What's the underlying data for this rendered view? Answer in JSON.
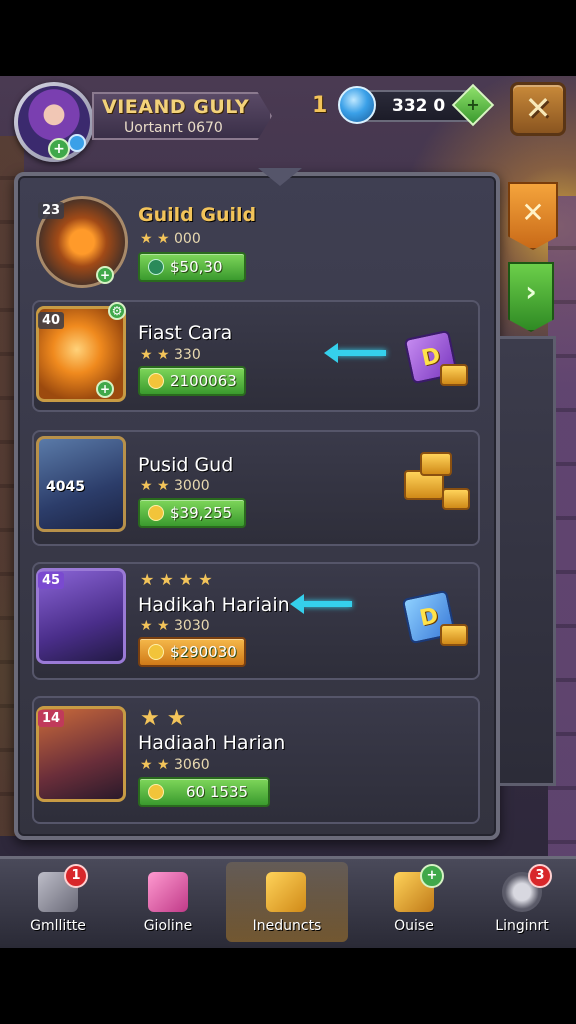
{
  "header": {
    "player_name": "VIEAND GULY",
    "player_subtitle": "Uortanrt 0670",
    "avatar_badge": "+",
    "level": "1",
    "currency_value": "332 0",
    "currency_add": "+",
    "close_label": "✕"
  },
  "side_tabs": {
    "close": "✕",
    "next": "›"
  },
  "rows": [
    {
      "level": "23",
      "title": "Guild Guild",
      "stars": "★ ★",
      "stars_value": "000",
      "price": "$50,30",
      "price_style": "green"
    },
    {
      "level": "40",
      "title": "Fiast Cara",
      "stars": "★ ★",
      "stars_value": "330",
      "price": "2100063",
      "price_style": "green",
      "reward_letter": "D"
    },
    {
      "level": "4045",
      "title": "Pusid Gud",
      "stars": "★ ★",
      "stars_value": "3000",
      "price": "$39,255",
      "price_style": "green"
    },
    {
      "level": "45",
      "title": "Hadikah Hariain",
      "top_stars": "★ ★ ★ ★",
      "stars": "★ ★",
      "stars_value": "3030",
      "price": "$290030",
      "price_style": "orange",
      "reward_letter": "D"
    },
    {
      "level": "14",
      "title": "Hadiaah Harian",
      "top_stars": "★ ★",
      "stars": "★ ★",
      "stars_value": "3060",
      "price": "60 1535",
      "price_style": "green"
    }
  ],
  "nav": [
    {
      "label": "Gmllitte",
      "badge": "1"
    },
    {
      "label": "Gioline",
      "badge": ""
    },
    {
      "label": "Ineduncts",
      "badge": ""
    },
    {
      "label": "Ouise",
      "badge": "+"
    },
    {
      "label": "Linginrt",
      "badge": "3"
    }
  ],
  "colors": {
    "accent_gold": "#f3c45a",
    "price_green": "#3a9a2e",
    "price_orange": "#d07a18",
    "arrow_cyan": "#35d0ec",
    "badge_red": "#d8262a"
  },
  "icons": {
    "gem": "gem-icon",
    "close": "close-icon",
    "next": "chevron-right-icon",
    "coin": "coin-icon",
    "reward": "reward-cube-icon"
  }
}
